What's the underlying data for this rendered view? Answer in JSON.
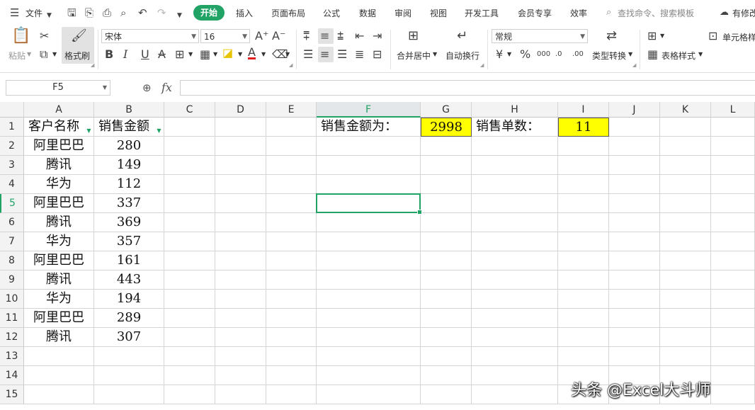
{
  "menubar": {
    "file": "文件",
    "tabs": [
      "开始",
      "插入",
      "页面布局",
      "公式",
      "数据",
      "审阅",
      "视图",
      "开发工具",
      "会员专享",
      "效率"
    ],
    "search": "查找命令、搜索模板",
    "modified": "有修改"
  },
  "ribbon": {
    "paste": "粘贴",
    "format_painter": "格式刷",
    "font_name": "宋体",
    "font_size": "16",
    "merge_center": "合并居中",
    "wrap_text": "自动换行",
    "number_format": "常规",
    "type_convert": "类型转换",
    "table_style": "表格样式",
    "cell_style": "单元格样"
  },
  "formula_bar": {
    "name_box": "F5",
    "fx": "fx",
    "value": ""
  },
  "columns": [
    "A",
    "B",
    "C",
    "D",
    "E",
    "F",
    "G",
    "H",
    "I",
    "J",
    "K",
    "L"
  ],
  "rows": [
    "1",
    "2",
    "3",
    "4",
    "5",
    "6",
    "7",
    "8",
    "9",
    "10",
    "11",
    "12",
    "13",
    "14",
    "15"
  ],
  "active_cell": {
    "col": "F",
    "row": "5"
  },
  "table": {
    "headers": [
      "客户名称",
      "销售金额"
    ],
    "data": [
      [
        "阿里巴巴",
        "280"
      ],
      [
        "腾讯",
        "149"
      ],
      [
        "华为",
        "112"
      ],
      [
        "阿里巴巴",
        "337"
      ],
      [
        "腾讯",
        "369"
      ],
      [
        "华为",
        "357"
      ],
      [
        "阿里巴巴",
        "161"
      ],
      [
        "腾讯",
        "443"
      ],
      [
        "华为",
        "194"
      ],
      [
        "阿里巴巴",
        "289"
      ],
      [
        "腾讯",
        "307"
      ]
    ]
  },
  "summary": {
    "amount_label": "销售金额为：",
    "amount_value": "2998",
    "count_label": "销售单数：",
    "count_value": "11",
    "highlight_color": "#ffff00"
  },
  "watermark": "头条 @Excel大斗师",
  "colors": {
    "accent": "#21a366"
  }
}
